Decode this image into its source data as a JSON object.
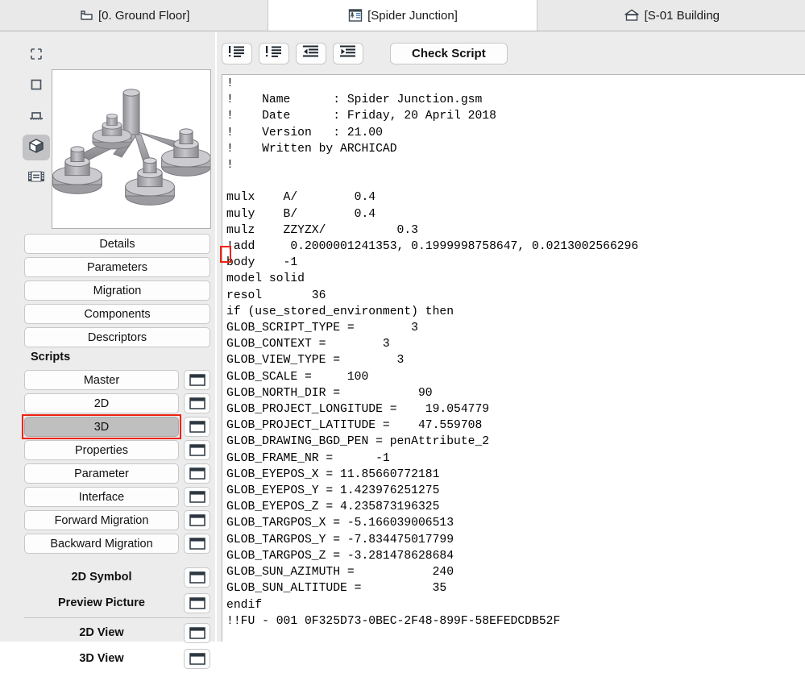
{
  "tabs": [
    {
      "icon": "floor-plan-icon",
      "label": "[0. Ground Floor]",
      "active": false
    },
    {
      "icon": "gdl-object-editor-icon",
      "label": "[Spider Junction]",
      "active": true
    },
    {
      "icon": "building-elevation-icon",
      "label": "[S-01 Building",
      "active": false
    }
  ],
  "sidebar": {
    "view_tools": [
      {
        "name": "preview-2d-symbol-icon",
        "selected": false
      },
      {
        "name": "preview-3d-box-icon",
        "selected": false
      },
      {
        "name": "preview-section-icon",
        "selected": false
      },
      {
        "name": "preview-3d-model-icon",
        "selected": true
      },
      {
        "name": "preview-filmstrip-icon",
        "selected": false
      }
    ],
    "preview": {
      "name": "object-3d-preview",
      "alt": "Spider Junction 3D model preview"
    },
    "main_buttons": [
      {
        "label": "Details"
      },
      {
        "label": "Parameters"
      },
      {
        "label": "Migration"
      },
      {
        "label": "Components"
      },
      {
        "label": "Descriptors"
      }
    ],
    "scripts_label": "Scripts",
    "scripts": [
      {
        "label": "Master",
        "selected": false
      },
      {
        "label": "2D",
        "selected": false
      },
      {
        "label": "3D",
        "selected": true
      },
      {
        "label": "Properties",
        "selected": false
      },
      {
        "label": "Parameter",
        "selected": false
      },
      {
        "label": "Interface",
        "selected": false
      },
      {
        "label": "Forward Migration",
        "selected": false
      },
      {
        "label": "Backward Migration",
        "selected": false
      }
    ],
    "symbols": [
      {
        "label": "2D Symbol"
      },
      {
        "label": "Preview Picture"
      }
    ],
    "views": [
      {
        "label": "2D View"
      },
      {
        "label": "3D View"
      }
    ]
  },
  "toolbar": {
    "buttons": [
      {
        "name": "comment-lines-icon",
        "label": ""
      },
      {
        "name": "uncomment-lines-icon",
        "label": ""
      },
      {
        "name": "indent-right-icon",
        "label": ""
      },
      {
        "name": "indent-left-icon",
        "label": ""
      }
    ],
    "check_script_label": "Check Script"
  },
  "editor": {
    "script_text": "!\n!    Name      : Spider Junction.gsm\n!    Date      : Friday, 20 April 2018\n!    Version   : 21.00\n!    Written by ARCHICAD\n!\n\nmulx    A/        0.4\nmuly    B/        0.4\nmulz    ZZYZX/          0.3\n!add     0.2000001241353, 0.1999998758647, 0.0213002566296\nbody    -1\nmodel solid\nresol       36\nif (use_stored_environment) then\nGLOB_SCRIPT_TYPE =        3\nGLOB_CONTEXT =        3\nGLOB_VIEW_TYPE =        3\nGLOB_SCALE =     100\nGLOB_NORTH_DIR =           90\nGLOB_PROJECT_LONGITUDE =    19.054779\nGLOB_PROJECT_LATITUDE =    47.559708\nGLOB_DRAWING_BGD_PEN = penAttribute_2\nGLOB_FRAME_NR =      -1\nGLOB_EYEPOS_X = 11.85660772181\nGLOB_EYEPOS_Y = 1.423976251275\nGLOB_EYEPOS_Z = 4.235873196325\nGLOB_TARGPOS_X = -5.166039006513\nGLOB_TARGPOS_Y = -7.834475017799\nGLOB_TARGPOS_Z = -3.281478628684\nGLOB_SUN_AZIMUTH =           240\nGLOB_SUN_ALTITUDE =          35\nendif\n!!FU - 001 0F325D73-0BEC-2F48-899F-58EFEDCDB52F"
  },
  "annotations": {
    "accent_color": "#ee2211",
    "highlight_script_button": "3D",
    "highlight_code_token": "!"
  }
}
